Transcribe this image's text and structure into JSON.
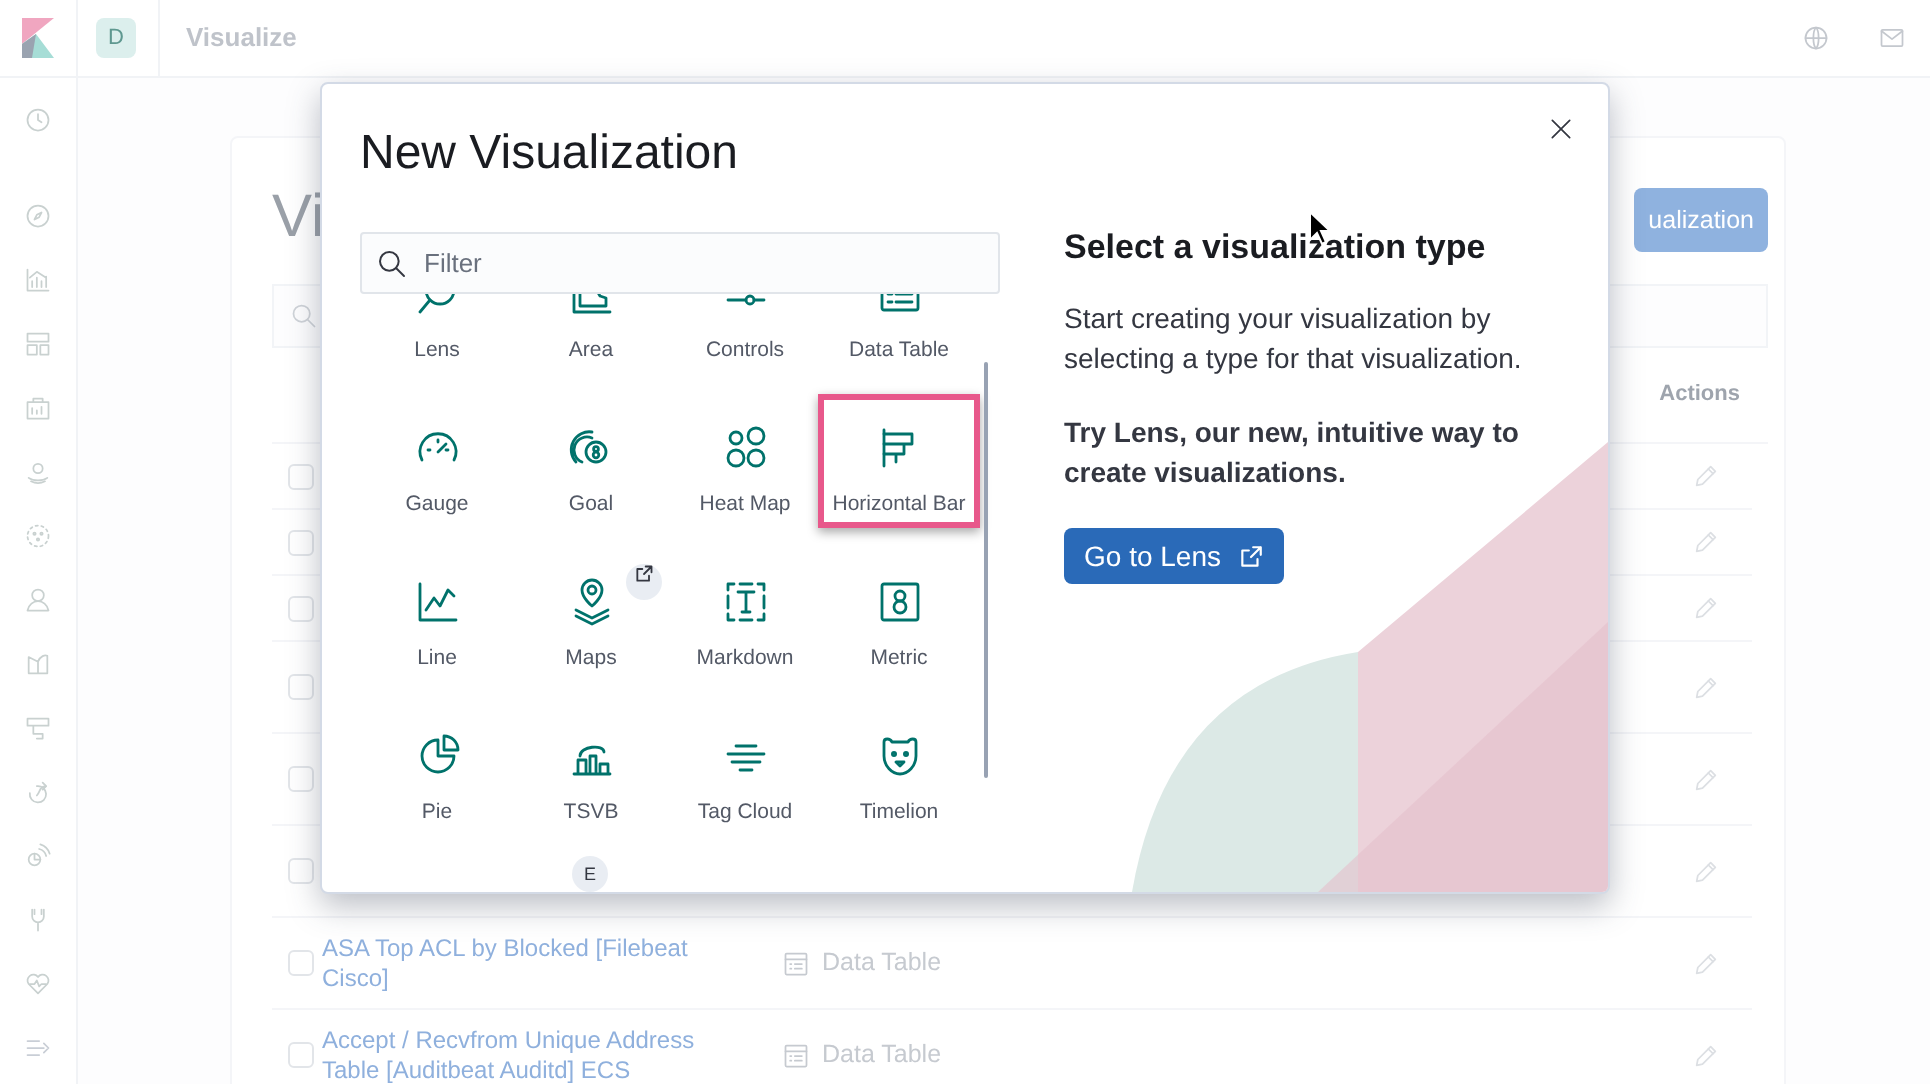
{
  "header": {
    "avatar": "D",
    "breadcrumb": "Visualize"
  },
  "page": {
    "title": "Vi",
    "create_button": "ualization",
    "table": {
      "columns": [
        {
          "label": "Actions"
        }
      ],
      "rows": [
        {
          "kind": "covered",
          "checked": false
        },
        {
          "kind": "covered",
          "checked": false
        },
        {
          "kind": "covered",
          "checked": false
        },
        {
          "kind": "covered",
          "checked": false
        },
        {
          "kind": "covered",
          "checked": false
        },
        {
          "kind": "covered",
          "checked": false
        },
        {
          "kind": "listed",
          "checked": false,
          "title": "ASA Top ACL by Blocked [Filebeat Cisco]",
          "type": "Data Table"
        },
        {
          "kind": "listed",
          "checked": false,
          "title": "Accept / Recvfrom Unique Address Table [Auditbeat Auditd] ECS",
          "type": "Data Table"
        }
      ]
    }
  },
  "modal": {
    "title": "New Visualization",
    "filter": {
      "placeholder": "Filter"
    },
    "types": [
      {
        "kind": "full",
        "label": "Lens",
        "selected": false,
        "external": false
      },
      {
        "kind": "full",
        "label": "Area",
        "selected": false,
        "external": false
      },
      {
        "kind": "full",
        "label": "Controls",
        "selected": false,
        "external": false
      },
      {
        "kind": "full",
        "label": "Data Table",
        "selected": false,
        "external": false
      },
      {
        "kind": "full",
        "label": "Gauge",
        "selected": false,
        "external": false
      },
      {
        "kind": "full",
        "label": "Goal",
        "selected": false,
        "external": false
      },
      {
        "kind": "full",
        "label": "Heat Map",
        "selected": false,
        "external": false
      },
      {
        "kind": "full",
        "label": "Horizontal Bar",
        "selected": true,
        "external": false
      },
      {
        "kind": "full",
        "label": "Line",
        "selected": false,
        "external": false
      },
      {
        "kind": "full",
        "label": "Maps",
        "selected": false,
        "external": true
      },
      {
        "kind": "full",
        "label": "Markdown",
        "selected": false,
        "external": false
      },
      {
        "kind": "full",
        "label": "Metric",
        "selected": false,
        "external": false
      },
      {
        "kind": "full",
        "label": "Pie",
        "selected": false,
        "external": false
      },
      {
        "kind": "full",
        "label": "TSVB",
        "selected": false,
        "external": false
      },
      {
        "kind": "full",
        "label": "Tag Cloud",
        "selected": false,
        "external": false
      },
      {
        "kind": "full",
        "label": "Timelion",
        "selected": false,
        "external": false
      },
      {
        "kind": "partial",
        "badge": "E",
        "selected": false,
        "external": false
      }
    ],
    "info": {
      "heading": "Select a visualization type",
      "description": "Start creating your visualization by selecting a type for that visualization.",
      "promo": "Try Lens, our new, intuitive way to create visualizations.",
      "button": "Go to Lens"
    }
  }
}
